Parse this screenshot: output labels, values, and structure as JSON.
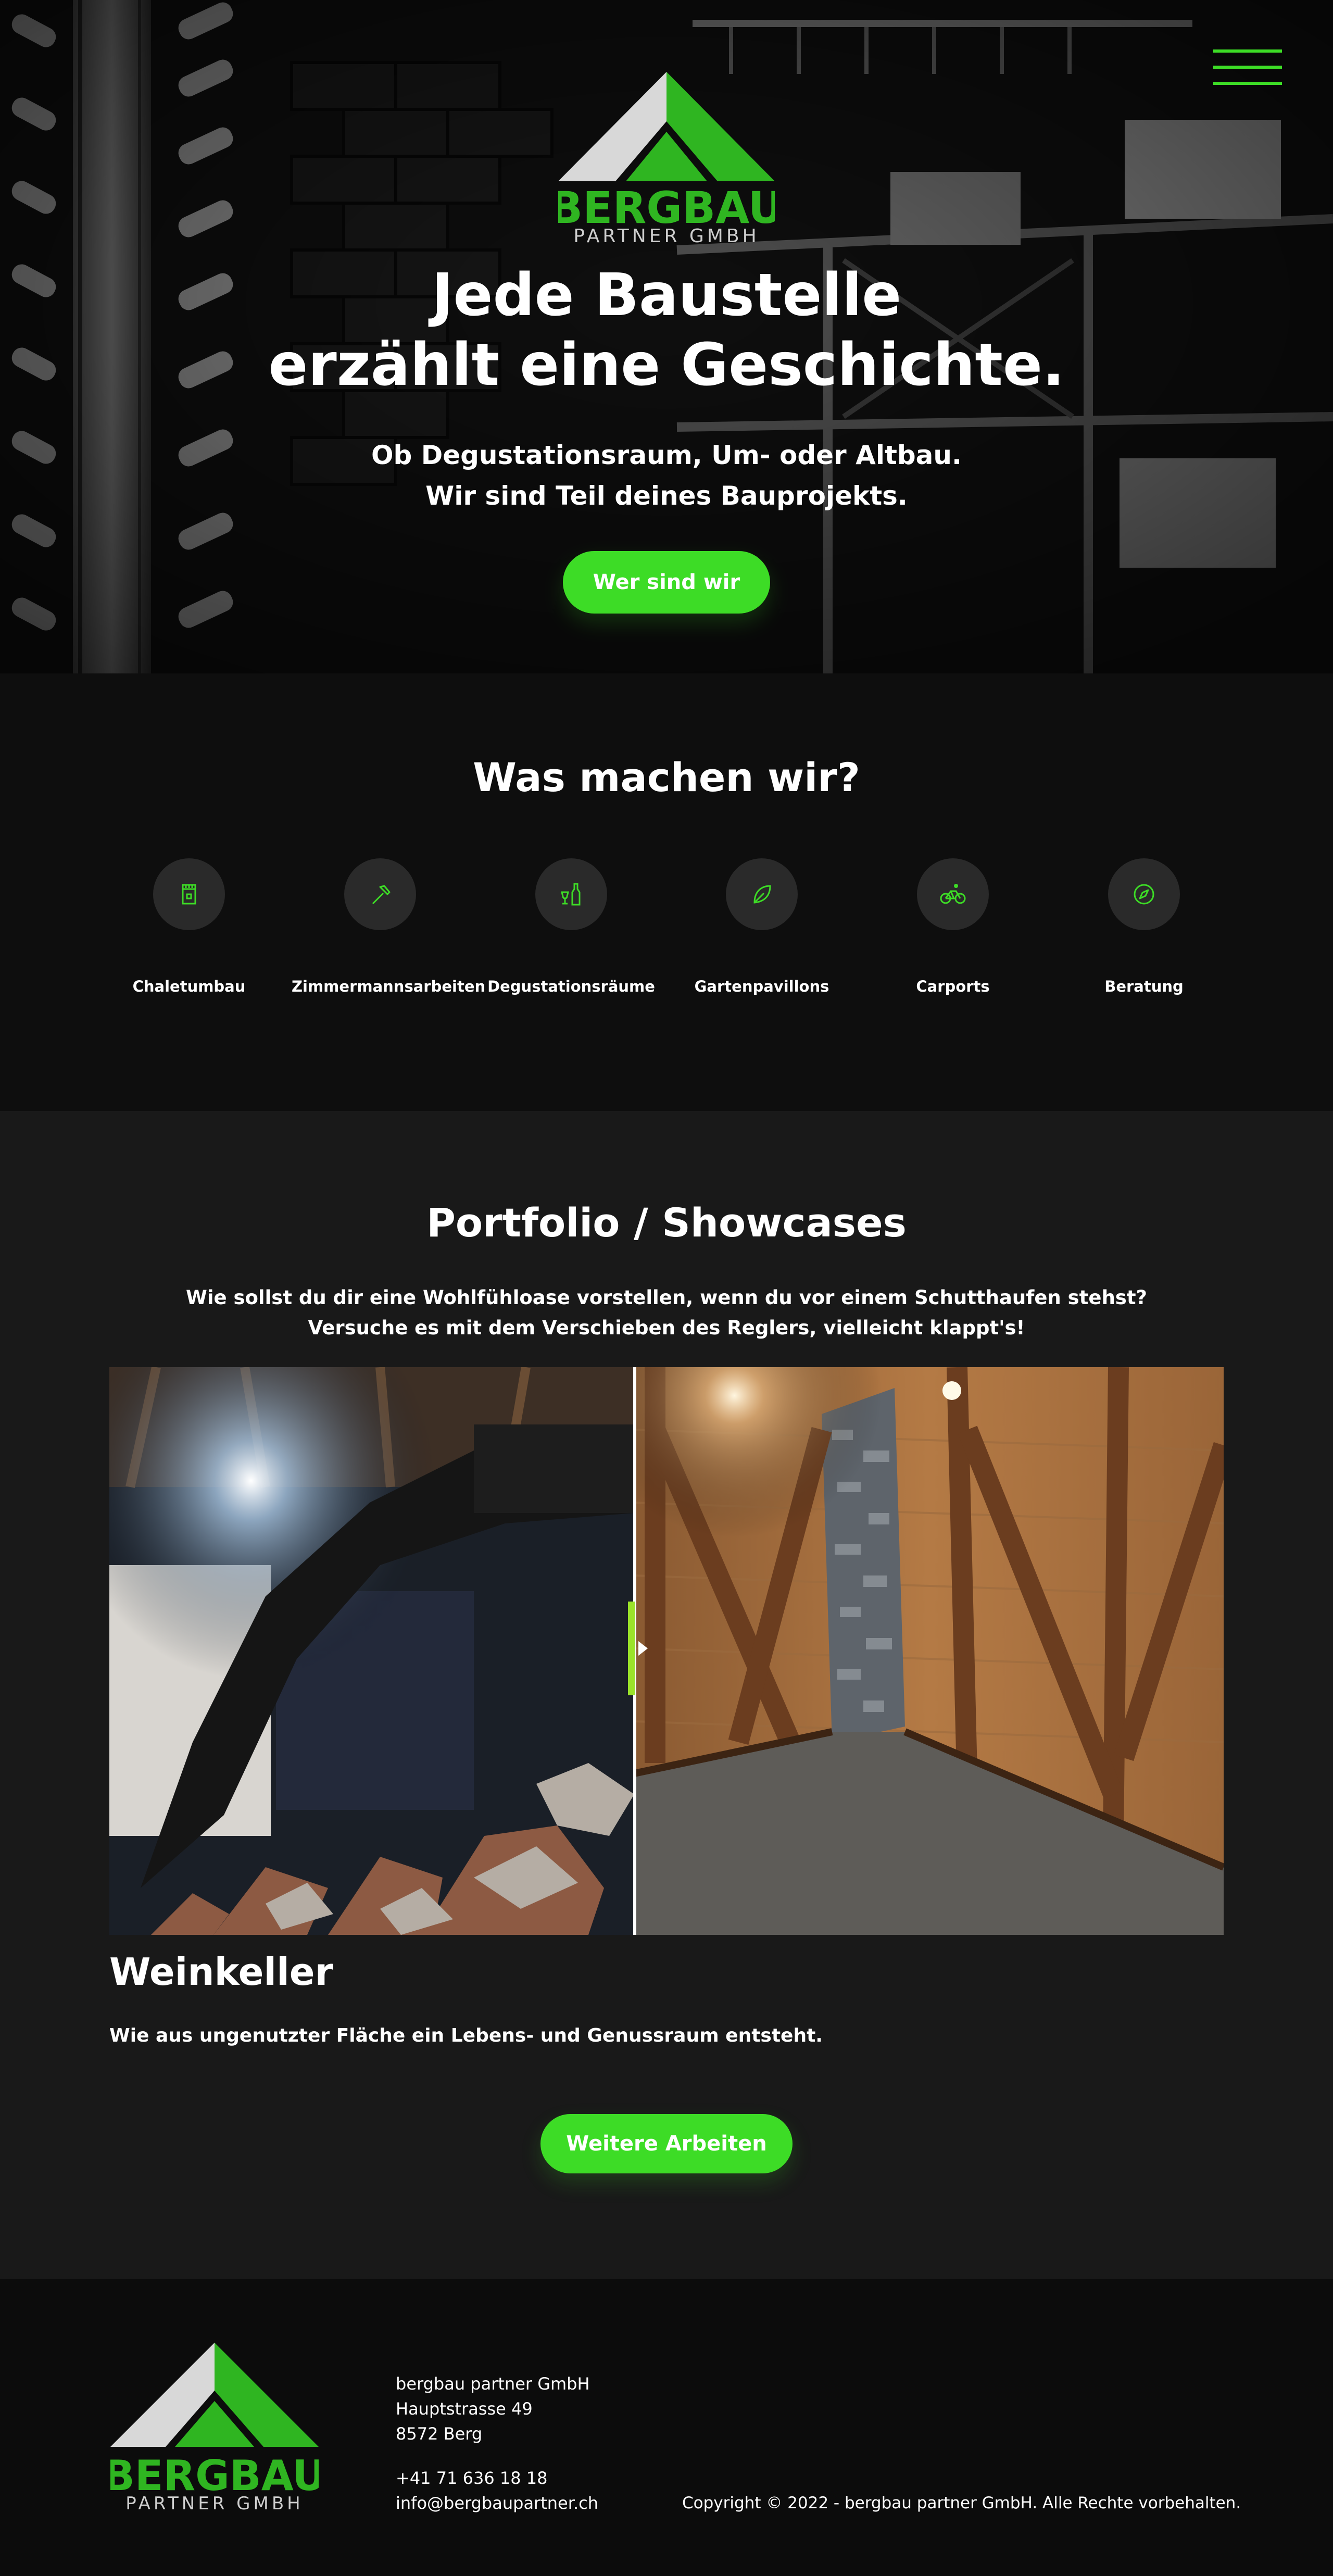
{
  "brand": {
    "name": "BERGBAU",
    "sub": "PARTNER GMBH",
    "green": "#3ddc26",
    "logo_green": "#2fb521"
  },
  "nav": {
    "menu_icon": "hamburger-icon"
  },
  "hero": {
    "title_line1": "Jede Baustelle",
    "title_line2": "erzählt eine Geschichte.",
    "sub_line1": "Ob Degustationsraum, Um- oder Altbau.",
    "sub_line2": "Wir sind Teil deines Bauprojekts.",
    "button": "Wer sind wir"
  },
  "services": {
    "title": "Was machen wir?",
    "items": [
      {
        "label": "Chaletumbau",
        "icon": "chalet-icon"
      },
      {
        "label": "Zimmermannsarbeiten",
        "icon": "hammer-icon"
      },
      {
        "label": "Degustationsräume",
        "icon": "wine-icon"
      },
      {
        "label": "Gartenpavillons",
        "icon": "leaf-icon"
      },
      {
        "label": "Carports",
        "icon": "bicycle-icon"
      },
      {
        "label": "Beratung",
        "icon": "compass-icon"
      }
    ]
  },
  "portfolio": {
    "title": "Portfolio / Showcases",
    "intro_line1": "Wie sollst du dir eine Wohlfühloase vorstellen, wenn du vor einem Schutthaufen stehst?",
    "intro_line2": "Versuche es mit dem Verschieben des Reglers, vielleicht klappt's!",
    "case_title": "Weinkeller",
    "case_desc": "Wie aus ungenutzter Fläche ein Lebens- und Genussraum entsteht.",
    "button": "Weitere Arbeiten"
  },
  "footer": {
    "company": "bergbau partner GmbH",
    "street": "Hauptstrasse 49",
    "city": "8572 Berg",
    "phone": "+41 71 636 18 18",
    "email": "info@bergbaupartner.ch",
    "copyright": "Copyright © 2022 - bergbau partner GmbH. Alle Rechte vorbehalten."
  }
}
